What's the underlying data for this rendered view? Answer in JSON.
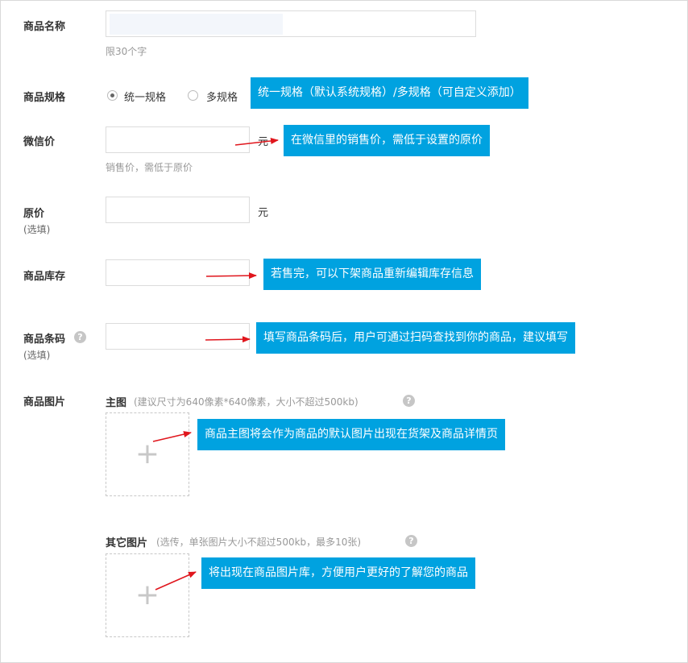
{
  "form": {
    "name": {
      "label": "商品名称",
      "value": "",
      "hint": "限30个字"
    },
    "spec": {
      "label": "商品规格",
      "options": [
        "统一规格",
        "多规格"
      ],
      "selected": "统一规格"
    },
    "wechat_price": {
      "label": "微信价",
      "value": "",
      "unit": "元",
      "hint": "销售价，需低于原价"
    },
    "original_price": {
      "label": "原价",
      "sublabel": "(选填)",
      "value": "",
      "unit": "元"
    },
    "stock": {
      "label": "商品库存",
      "value": ""
    },
    "barcode": {
      "label": "商品条码",
      "sublabel": "(选填)",
      "value": "",
      "help": "?"
    },
    "images": {
      "label": "商品图片",
      "main": {
        "title": "主图",
        "note": "(建议尺寸为640像素*640像素，大小不超过500kb)",
        "help": "?",
        "plus": "+"
      },
      "other": {
        "title": "其它图片",
        "note": "(选传，单张图片大小不超过500kb，最多10张)",
        "help": "?",
        "plus": "+"
      }
    }
  },
  "callouts": {
    "spec": "统一规格（默认系统规格）/多规格（可自定义添加）",
    "wechat_price": "在微信里的销售价，需低于设置的原价",
    "stock": "若售完，可以下架商品重新编辑库存信息",
    "barcode": "填写商品条码后，用户可通过扫码查找到你的商品，建议填写",
    "main_image": "商品主图将会作为商品的默认图片出现在货架及商品详情页",
    "other_images": "将出现在商品图片库，方便用户更好的了解您的商品"
  },
  "colors": {
    "callout_bg": "#00a2e0",
    "arrow": "#e0161d",
    "input_border": "#dcdcdc"
  }
}
